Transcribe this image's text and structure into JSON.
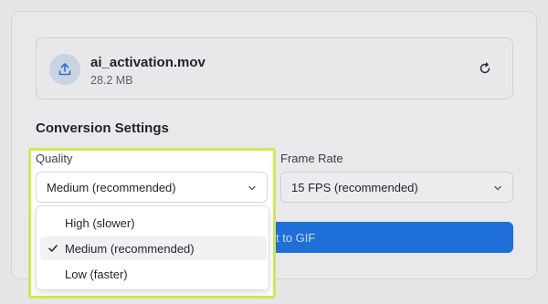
{
  "file": {
    "name": "ai_activation.mov",
    "size": "28.2 MB"
  },
  "settings": {
    "title": "Conversion Settings",
    "quality": {
      "label": "Quality",
      "selected": "Medium (recommended)",
      "options": [
        "High (slower)",
        "Medium (recommended)",
        "Low (faster)"
      ]
    },
    "frame_rate": {
      "label": "Frame Rate",
      "selected": "15 FPS (recommended)"
    }
  },
  "convert_button": {
    "label_visible": "t to GIF"
  },
  "colors": {
    "accent": "#1f6fd8",
    "highlight": "#cfe954"
  },
  "icons": {
    "upload": "upload-icon",
    "reset": "reset-icon",
    "chevron": "chevron-down-icon",
    "check": "check-icon"
  }
}
